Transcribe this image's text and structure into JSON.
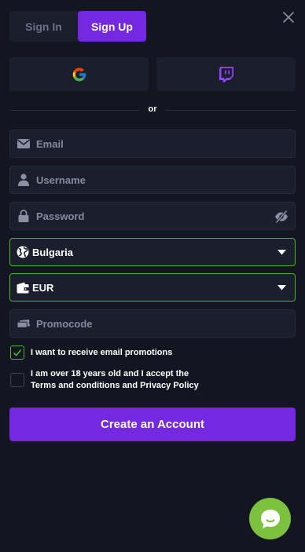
{
  "tabs": {
    "signin": "Sign In",
    "signup": "Sign Up"
  },
  "divider": {
    "text": "or"
  },
  "fields": {
    "email": "Email",
    "username": "Username",
    "password": "Password",
    "country": "Bulgaria",
    "currency": "EUR",
    "promocode": "Promocode"
  },
  "checkboxes": {
    "promotions": {
      "label": "I want to receive email promotions",
      "checked": true
    },
    "terms": {
      "line1": "I am over 18 years old and I accept the",
      "line2": "Terms and conditions and Privacy Policy",
      "checked": false
    }
  },
  "cta": {
    "label": "Create an Account"
  },
  "icons": {
    "close": "close-icon",
    "google": "google-icon",
    "twitch": "twitch-icon",
    "email": "envelope-icon",
    "username": "user-icon",
    "password": "lock-icon",
    "eye": "eye-slash-icon",
    "country": "globe-icon",
    "currency": "wallet-icon",
    "promocode": "ticket-icon",
    "chat": "chat-icon"
  },
  "colors": {
    "accent": "#7428e0",
    "success": "#4bb32a",
    "chat": "#7cc23f",
    "background": "#131520",
    "field": "#1b1e2c"
  }
}
